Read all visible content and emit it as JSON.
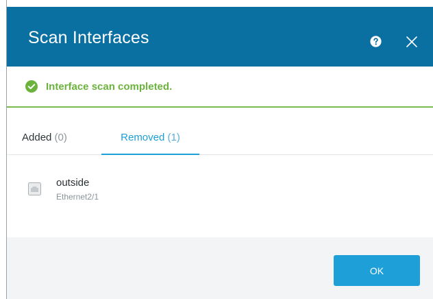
{
  "dialog": {
    "title": "Scan Interfaces",
    "help_icon": "question-circle-icon",
    "close_icon": "close-icon"
  },
  "banner": {
    "icon": "check-circle-icon",
    "message": "Interface scan completed.",
    "color": "#6bb33d"
  },
  "tabs": [
    {
      "label": "Added",
      "count": "(0)",
      "active": false
    },
    {
      "label": "Removed",
      "count": "(1)",
      "active": true
    }
  ],
  "items": [
    {
      "icon": "ethernet-port-icon",
      "name": "outside",
      "subtitle": "Ethernet2/1"
    }
  ],
  "footer": {
    "ok_label": "OK"
  },
  "colors": {
    "header_bg": "#0a6fa1",
    "accent": "#1a9fd7",
    "success": "#76bb4b",
    "footer_bg": "#f2f4f5"
  }
}
